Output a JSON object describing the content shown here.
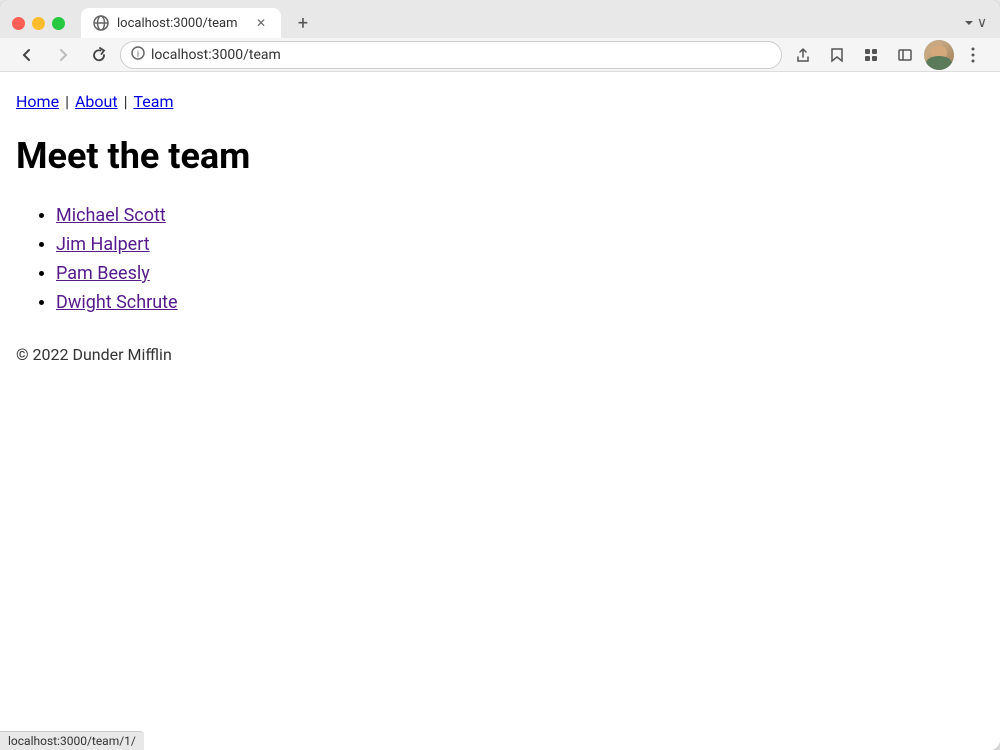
{
  "browser": {
    "url": "localhost:3000/team",
    "tab_title": "localhost:3000/team",
    "status_url": "localhost:3000/team/1/"
  },
  "nav": {
    "back_icon": "←",
    "forward_icon": "→",
    "reload_icon": "↺",
    "share_icon": "⎋",
    "bookmark_icon": "☆",
    "extensions_icon": "🧩",
    "sidebar_icon": "▣",
    "more_icon": "⋮"
  },
  "breadcrumb": {
    "home": "Home",
    "separator1": "|",
    "about": "About",
    "separator2": "|",
    "team": "Team"
  },
  "page": {
    "heading": "Meet the team",
    "team_members": [
      {
        "name": "Michael Scott",
        "href": "/team/1"
      },
      {
        "name": "Jim Halpert",
        "href": "/team/2"
      },
      {
        "name": "Pam Beesly",
        "href": "/team/3"
      },
      {
        "name": "Dwight Schrute",
        "href": "/team/4"
      }
    ],
    "footer": "© 2022 Dunder Mifflin"
  }
}
